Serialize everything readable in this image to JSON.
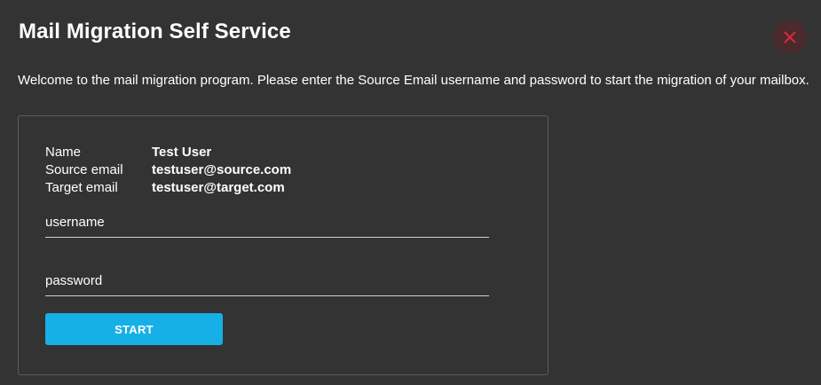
{
  "dialog": {
    "title": "Mail Migration Self Service",
    "close_icon": "close-icon",
    "welcome_text": "Welcome to the mail migration program. Please enter the Source Email username and password to start the migration of your mailbox."
  },
  "user_info": [
    {
      "label": "Name",
      "value": "Test User"
    },
    {
      "label": "Source email",
      "value": "testuser@source.com"
    },
    {
      "label": "Target email",
      "value": "testuser@target.com"
    }
  ],
  "form": {
    "username_placeholder": "username",
    "username_value": "",
    "password_placeholder": "password",
    "password_value": "",
    "start_label": "START"
  },
  "colors": {
    "background": "#333333",
    "accent": "#16b0e6",
    "close_icon": "#d92b3a",
    "close_bg": "#4a2a2d"
  }
}
